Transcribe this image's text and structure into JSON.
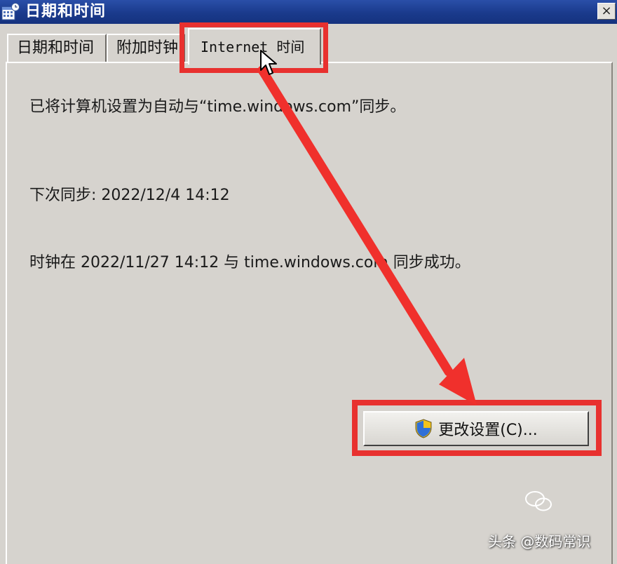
{
  "window": {
    "title": "日期和时间",
    "close_label": "×"
  },
  "tabs": [
    {
      "label": "日期和时间",
      "selected": false
    },
    {
      "label": "附加时钟",
      "selected": false
    },
    {
      "label": "Internet 时间",
      "selected": true
    }
  ],
  "content": {
    "sync_message": "已将计算机设置为自动与“time.windows.com”同步。",
    "next_sync": "下次同步: 2022/12/4 14:12",
    "last_sync": "时钟在 2022/11/27 14:12 与 time.windows.com 同步成功。"
  },
  "buttons": {
    "change_settings": "更改设置(C)..."
  },
  "annotation": {
    "highlight_color": "#e8312f",
    "arrow_color": "#f0302c"
  },
  "watermark": {
    "text": "头条 @数码常识"
  }
}
